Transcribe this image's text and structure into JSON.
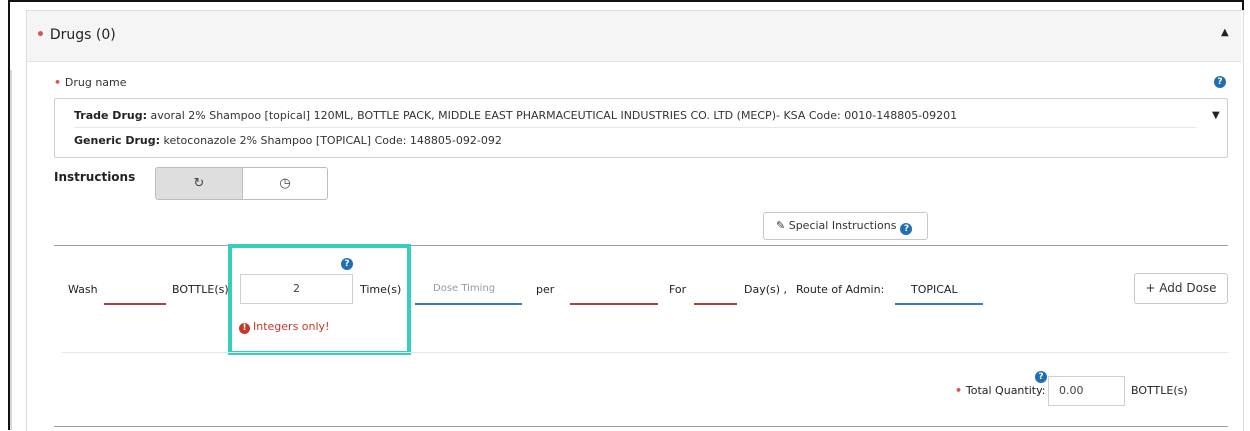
{
  "section": {
    "title": "Drugs (0)"
  },
  "drug": {
    "label": "Drug name",
    "trade_prefix": "Trade Drug:",
    "trade_value": "avoral 2% Shampoo [topical] 120ML, BOTTLE PACK, MIDDLE EAST PHARMACEUTICAL INDUSTRIES CO. LTD (MECP)- KSA Code: 0010-148805-09201",
    "generic_prefix": "Generic Drug:",
    "generic_value": "ketoconazole 2% Shampoo [TOPICAL] Code: 148805-092-092"
  },
  "instructions": {
    "label": "Instructions",
    "modes": [
      {
        "name": "repeat-mode",
        "icon": "refresh-icon",
        "glyph": "↻",
        "selected": true
      },
      {
        "name": "schedule-mode",
        "icon": "clock-icon",
        "glyph": "◷",
        "selected": false
      }
    ],
    "special_button": "Special Instructions"
  },
  "dose_row": {
    "action": "Wash",
    "unit": "BOTTLE(s)",
    "quantity_value": "2",
    "times_label": "Time(s)",
    "dose_timing_placeholder": "Dose Timing",
    "per_label": "per",
    "for_label": "For",
    "days_label": "Day(s) ,",
    "route_label": "Route of Admin:",
    "route_value": "TOPICAL",
    "error": "Integers only!",
    "add_dose_button": "+ Add Dose"
  },
  "total": {
    "label": "Total Quantity:",
    "value": "0.00",
    "unit": "BOTTLE(s)"
  },
  "colors": {
    "highlight": "#35cfc1",
    "required": "#d9534f",
    "error": "#c0392b",
    "help": "#1f6fb2"
  },
  "icons": {
    "help": "?",
    "caret_up": "▲",
    "caret_down": "▼",
    "pencil": "✎",
    "error": "!"
  }
}
